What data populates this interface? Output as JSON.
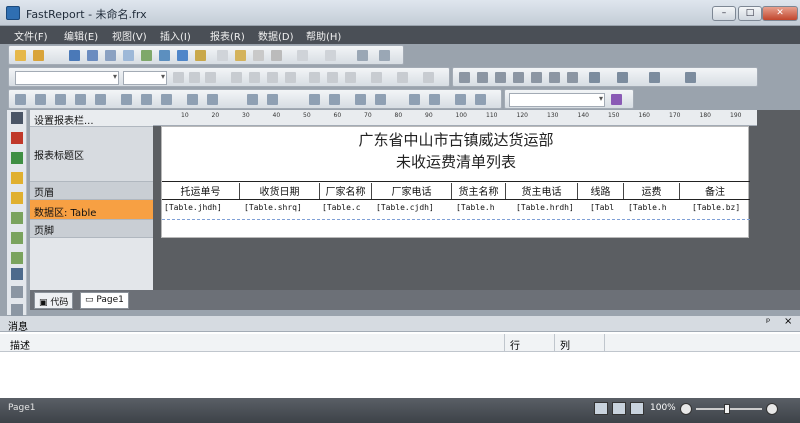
{
  "window": {
    "title": "FastReport - 未命名.frx",
    "min": "–",
    "max": "□",
    "close": "✕"
  },
  "menu": [
    "文件(F)",
    "编辑(E)",
    "视图(V)",
    "插入(I)",
    "报表(R)",
    "数据(D)",
    "帮助(H)"
  ],
  "bands": {
    "page_header_setup": "设置报表栏...",
    "report_title": "报表标题区",
    "page_header": "页眉",
    "data": "数据区: Table",
    "page_footer": "页脚"
  },
  "ruler_ticks": [
    "10",
    "20",
    "30",
    "40",
    "50",
    "60",
    "70",
    "80",
    "90",
    "100",
    "110",
    "120",
    "130",
    "140",
    "150",
    "160",
    "170",
    "180",
    "190"
  ],
  "report": {
    "title1": "广东省中山市古镇威达货运部",
    "title2": "未收运费清单列表",
    "headers": [
      "托运单号",
      "收货日期",
      "厂家名称",
      "厂家电话",
      "货主名称",
      "货主电话",
      "线路",
      "运费",
      "备注"
    ],
    "data": [
      "[Table.jhdh]",
      "[Table.shrq]",
      "[Table.c",
      "[Table.cjdh]",
      "[Table.h",
      "[Table.hrdh]",
      "[Tabl",
      "[Table.h",
      "[Table.bz]"
    ]
  },
  "tabs": {
    "code": "代码",
    "page1": "Page1"
  },
  "messages": {
    "title": "消息",
    "pin": "ᵖ",
    "close": "×",
    "col_desc": "描述",
    "col_line": "行",
    "col_col": "列"
  },
  "status": {
    "page": "Page1",
    "zoom": "100%"
  }
}
